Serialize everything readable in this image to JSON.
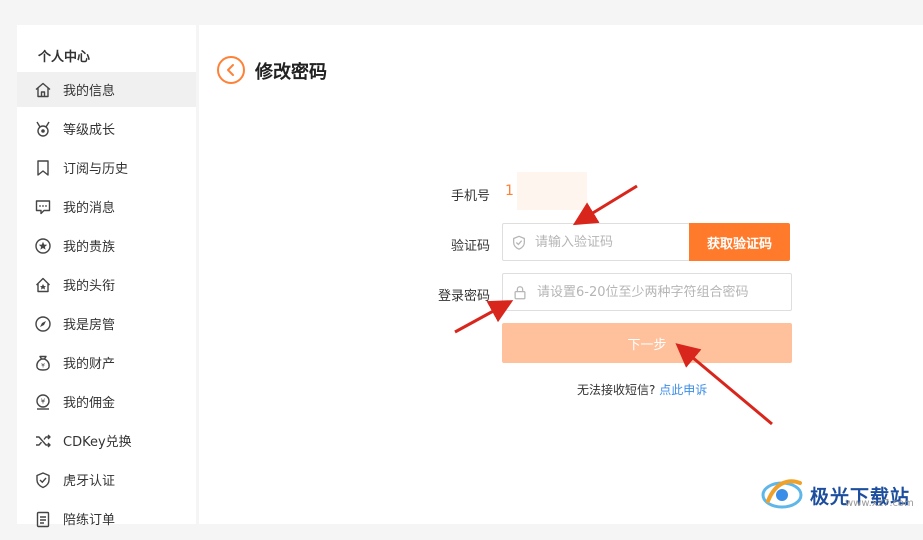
{
  "sidebar": {
    "title": "个人中心",
    "items": [
      {
        "label": "我的信息",
        "icon": "home-icon",
        "active": true
      },
      {
        "label": "等级成长",
        "icon": "medal-icon"
      },
      {
        "label": "订阅与历史",
        "icon": "bookmark-icon"
      },
      {
        "label": "我的消息",
        "icon": "message-icon"
      },
      {
        "label": "我的贵族",
        "icon": "star-badge-icon"
      },
      {
        "label": "我的头衔",
        "icon": "house-title-icon"
      },
      {
        "label": "我是房管",
        "icon": "compass-icon"
      },
      {
        "label": "我的财产",
        "icon": "money-bag-icon"
      },
      {
        "label": "我的佣金",
        "icon": "commission-icon"
      },
      {
        "label": "CDKey兑换",
        "icon": "shuffle-icon"
      },
      {
        "label": "虎牙认证",
        "icon": "shield-check-icon"
      },
      {
        "label": "陪练订单",
        "icon": "order-icon"
      }
    ]
  },
  "main": {
    "title": "修改密码",
    "phone_label": "手机号",
    "phone_value": "1",
    "code_label": "验证码",
    "code_placeholder": "请输入验证码",
    "get_code_label": "获取验证码",
    "password_label": "登录密码",
    "password_placeholder": "请设置6-20位至少两种字符组合密码",
    "next_label": "下一步",
    "help_text": "无法接收短信?",
    "help_link": "点此申诉"
  },
  "watermark": {
    "text": "极光下载站",
    "url": "www.xz7.com"
  },
  "colors": {
    "accent": "#ff7a2a",
    "next_disabled": "#ffc19c",
    "link": "#3b8ee8",
    "arrow": "#d9261c"
  }
}
